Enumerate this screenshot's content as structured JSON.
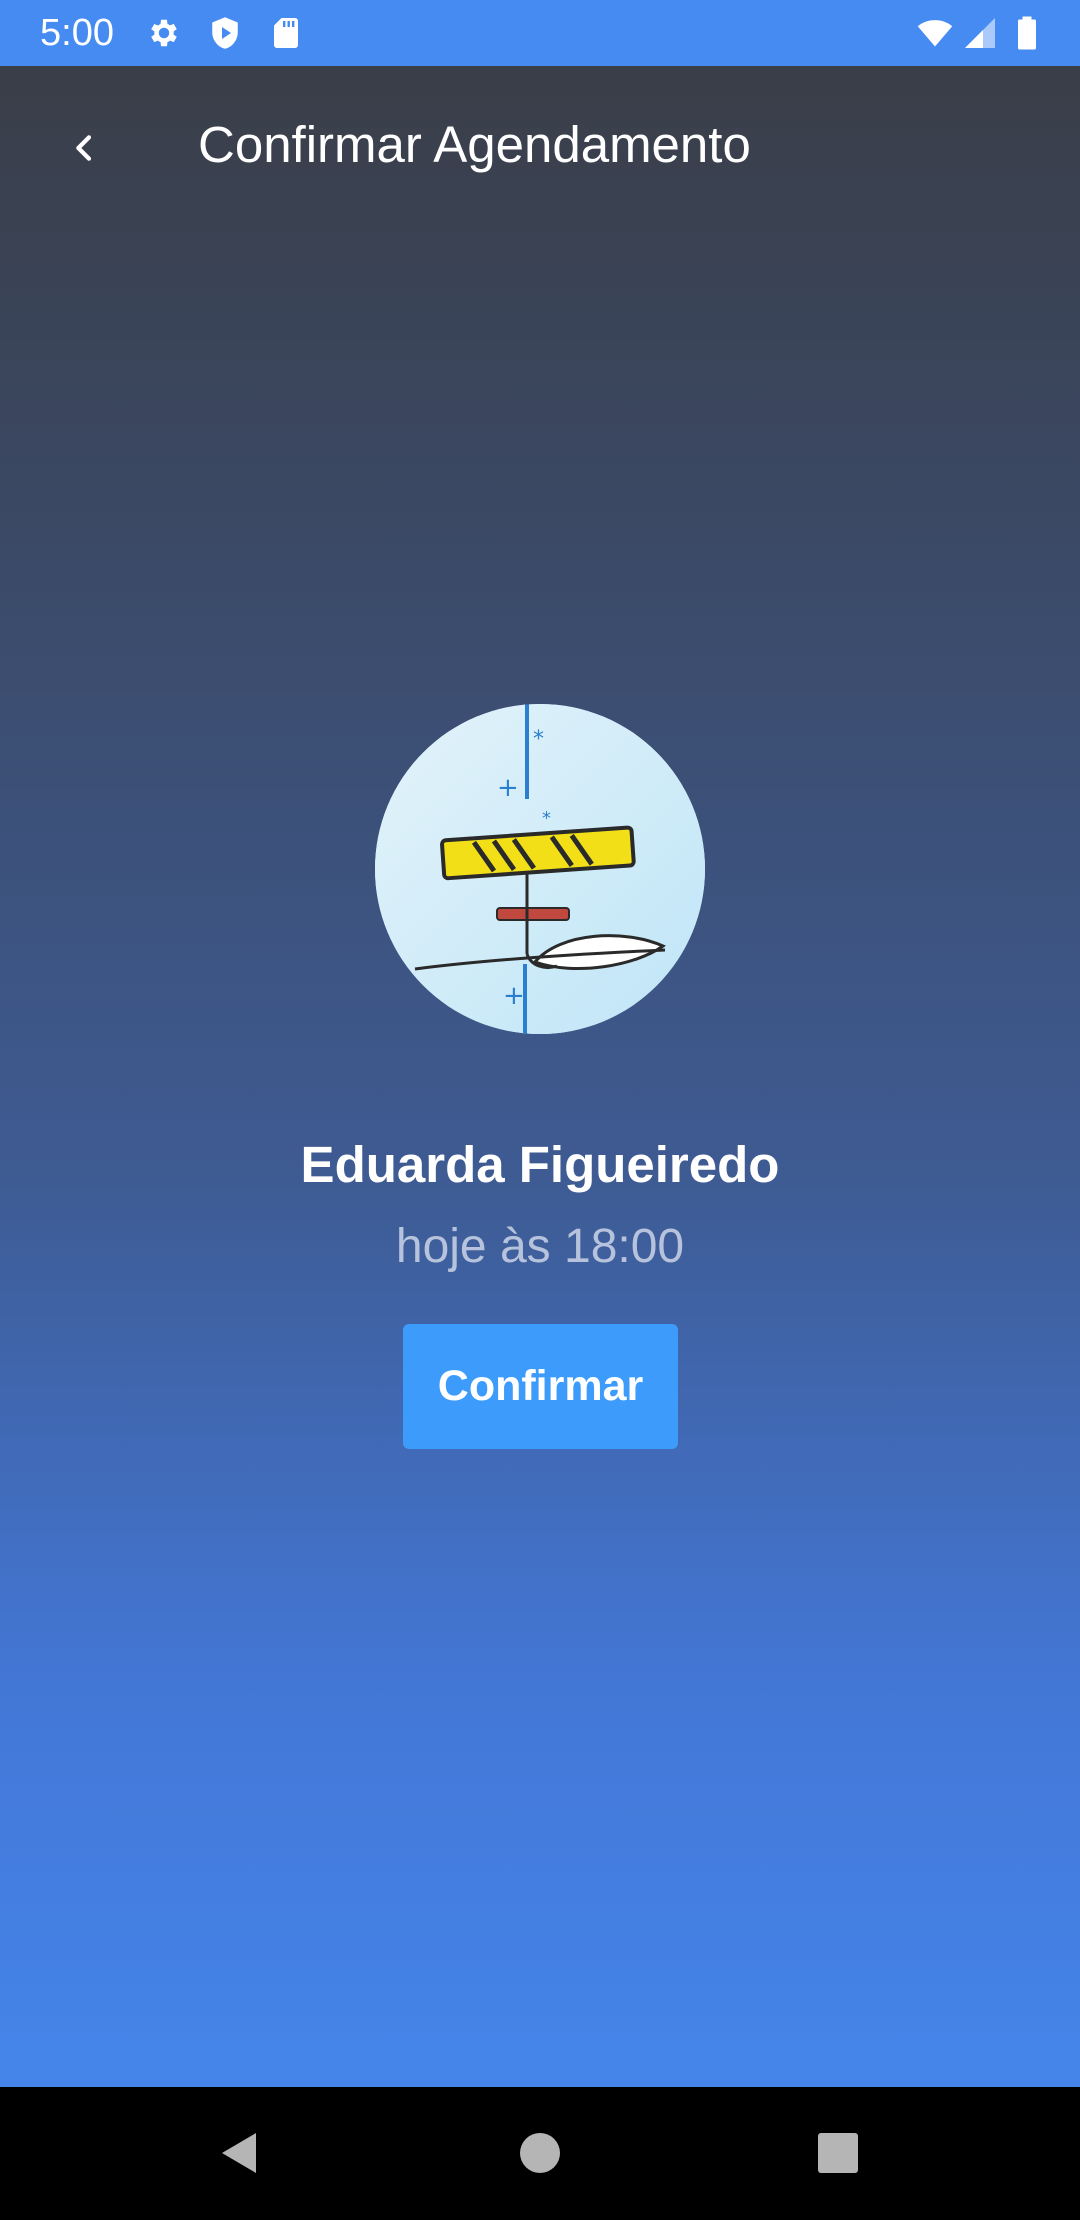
{
  "status_bar": {
    "time": "5:00",
    "background": "#458bf2",
    "icons": [
      "settings-icon",
      "play-protect-icon",
      "sd-card-icon",
      "wifi-icon",
      "signal-icon",
      "battery-icon"
    ]
  },
  "app_bar": {
    "title": "Confirmar Agendamento",
    "back_icon": "chevron-left-icon"
  },
  "appointment": {
    "name": "Eduarda Figueiredo",
    "time": "hoje às 18:00",
    "avatar_description": "illustration"
  },
  "actions": {
    "confirm_label": "Confirmar",
    "confirm_color": "#3d9bfb"
  },
  "nav_bar": {
    "icons": [
      "back-triangle-icon",
      "home-circle-icon",
      "recents-square-icon"
    ]
  },
  "colors": {
    "gradient_top": "#3a3e48",
    "gradient_bottom": "#4585ea",
    "subtitle": "#b7c3dc"
  }
}
